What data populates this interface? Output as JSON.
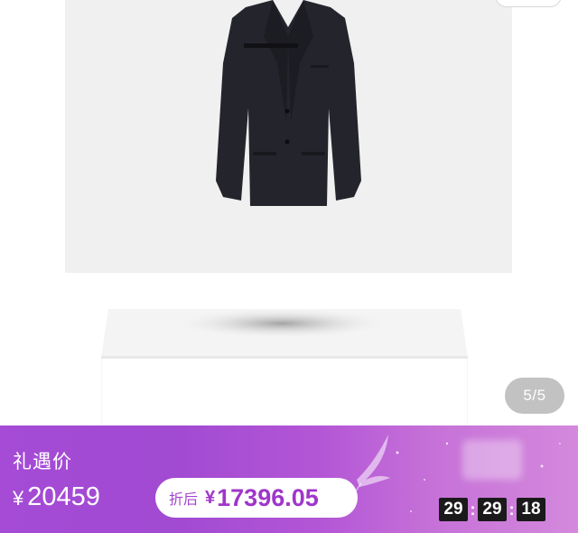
{
  "product": {
    "image_alt": "black-blazer",
    "gallery_counter": "5/5"
  },
  "promo": {
    "label": "礼遇价",
    "original_currency": "¥",
    "original_price": "20459",
    "after_discount_label": "折后",
    "discount_currency": "¥",
    "discount_price": "17396.05",
    "countdown": {
      "hours": "29",
      "minutes": "29",
      "seconds": "18",
      "separator": ":"
    },
    "colors": {
      "gradient_start": "#a54bd6",
      "gradient_end": "#d489dc",
      "discount_text": "#9f36c9",
      "countdown_bg": "#1a1a1a"
    }
  }
}
